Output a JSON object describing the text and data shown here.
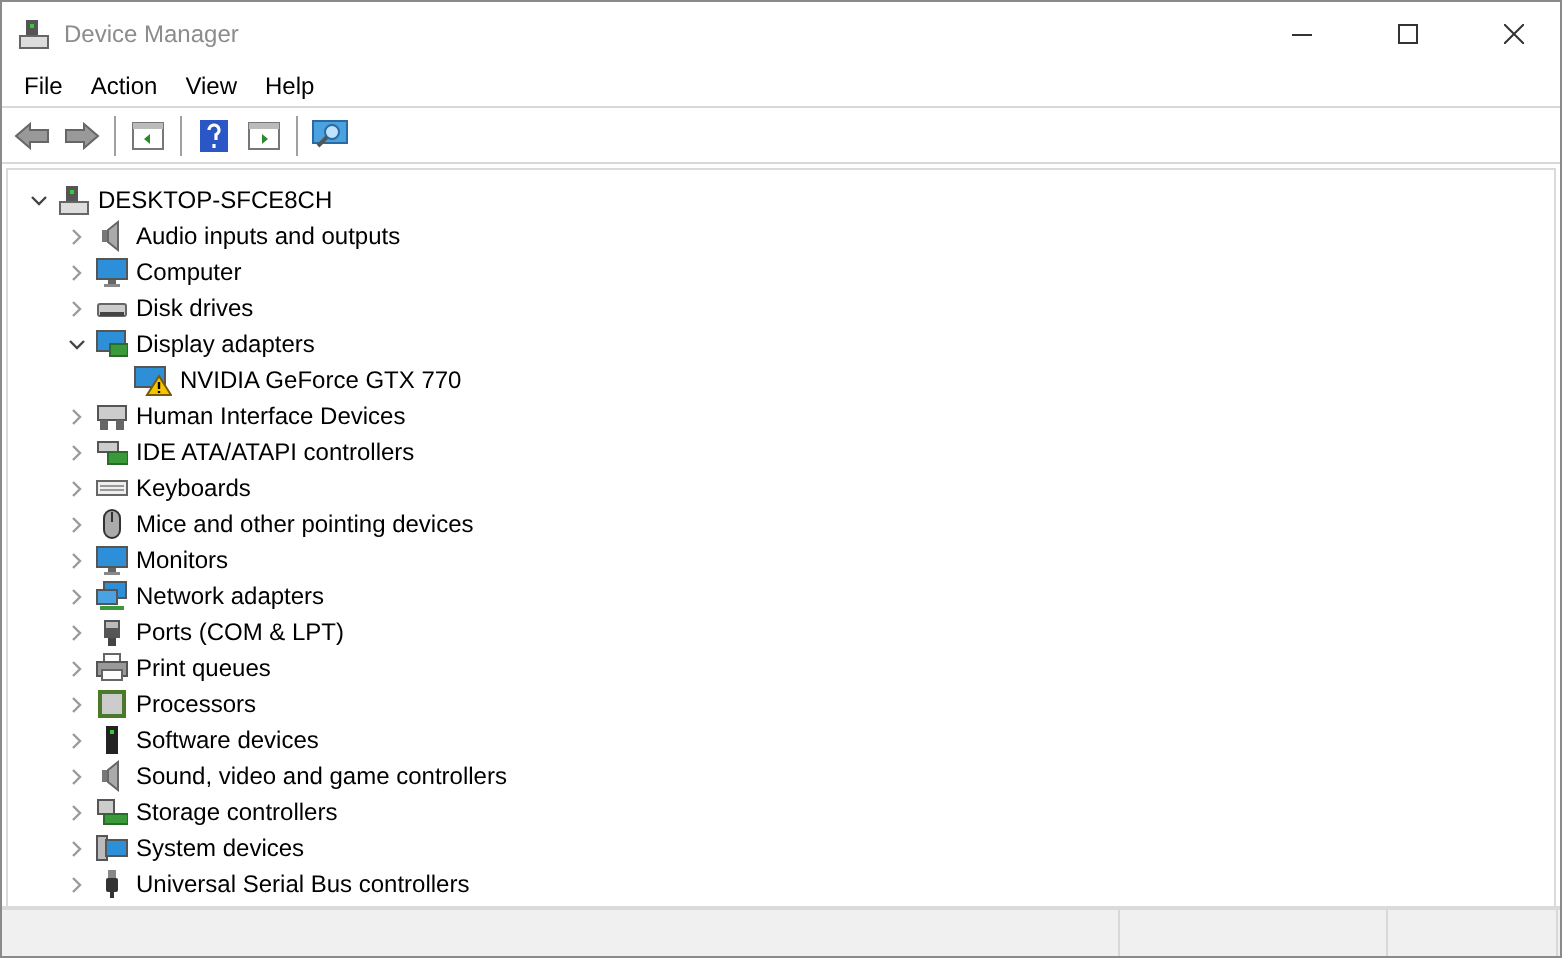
{
  "window": {
    "title": "Device Manager"
  },
  "menu": [
    "File",
    "Action",
    "View",
    "Help"
  ],
  "tree": {
    "label": "DESKTOP-SFCE8CH",
    "expanded": true,
    "children": [
      {
        "label": "Audio inputs and outputs",
        "expanded": false
      },
      {
        "label": "Computer",
        "expanded": false
      },
      {
        "label": "Disk drives",
        "expanded": false
      },
      {
        "label": "Display adapters",
        "expanded": true,
        "children": [
          {
            "label": "NVIDIA GeForce GTX 770",
            "warning": true
          }
        ]
      },
      {
        "label": "Human Interface Devices",
        "expanded": false
      },
      {
        "label": "IDE ATA/ATAPI controllers",
        "expanded": false
      },
      {
        "label": "Keyboards",
        "expanded": false
      },
      {
        "label": "Mice and other pointing devices",
        "expanded": false
      },
      {
        "label": "Monitors",
        "expanded": false
      },
      {
        "label": "Network adapters",
        "expanded": false
      },
      {
        "label": "Ports (COM & LPT)",
        "expanded": false
      },
      {
        "label": "Print queues",
        "expanded": false
      },
      {
        "label": "Processors",
        "expanded": false
      },
      {
        "label": "Software devices",
        "expanded": false
      },
      {
        "label": "Sound, video and game controllers",
        "expanded": false
      },
      {
        "label": "Storage controllers",
        "expanded": false
      },
      {
        "label": "System devices",
        "expanded": false
      },
      {
        "label": "Universal Serial Bus controllers",
        "expanded": false
      }
    ]
  }
}
